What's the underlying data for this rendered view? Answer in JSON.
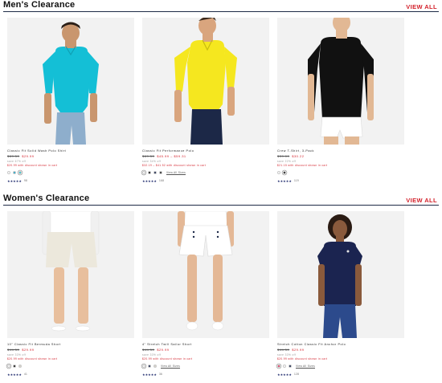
{
  "men": {
    "title": "Men's Clearance",
    "view_all": "VIEW ALL",
    "products": [
      {
        "name": "Classic Fit Solid Wash Polo Shirt",
        "was": "$89.50",
        "now": "$29.99",
        "save": "save 67% off",
        "promo": "$20.99 with discount shown in cart",
        "swatches": [
          "#ffffff",
          "#1aa7cc",
          "#1ec9d8"
        ],
        "selected": 2,
        "view_more": "",
        "stars": "★★★★★",
        "count": "98"
      },
      {
        "name": "Classic Fit Performance Polo",
        "was": "$89.50",
        "now": "$45.99 – $59.31",
        "save": "save 34% off",
        "promo": "$32.19 – $41.52 with discount shown in cart",
        "swatches": [
          "#ffffff",
          "#111111",
          "#15224a",
          "#222222"
        ],
        "selected": 0,
        "view_more": "View All Sizes",
        "stars": "★★★★★",
        "count": "168"
      },
      {
        "name": "Crew T-Shirt, 3-Pack",
        "was": "$39.00",
        "now": "$30.22",
        "save": "save 22% off",
        "promo": "$21.15 with discount shown in cart",
        "swatches": [
          "#ffffff",
          "#111111"
        ],
        "selected": 1,
        "view_more": "",
        "stars": "★★★★★",
        "count": "119"
      }
    ]
  },
  "women": {
    "title": "Women's Clearance",
    "view_all": "VIEW ALL",
    "products": [
      {
        "name": "10\" Classic Fit Bermuda Short",
        "was": "$44.50",
        "now": "$29.99",
        "save": "save 33% off",
        "promo": "$20.99 with discount shown in cart",
        "swatches": [
          "#ffffff",
          "#111111",
          "#d9d6cc"
        ],
        "selected": 0,
        "view_more": "",
        "stars": "★★★★★",
        "count": "41"
      },
      {
        "name": "4\" Stretch Twill Sailor Short",
        "was": "$44.50",
        "now": "$29.99",
        "save": "save 33% off",
        "promo": "$20.99 with discount shown in cart",
        "swatches": [
          "#ffffff",
          "#15224a",
          "#d9d6cc"
        ],
        "selected": 0,
        "view_more": "View All Sizes",
        "stars": "★★★★★",
        "count": "36"
      },
      {
        "name": "Stretch Cotton Classic Fit Anchor Polo",
        "was": "$44.50",
        "now": "$29.99",
        "save": "save 33% off",
        "promo": "$20.99 with discount shown in cart",
        "swatches": [
          "#e52b5a",
          "#ffffff",
          "#15224a"
        ],
        "selected": 0,
        "view_more": "View All Sizes",
        "stars": "★★★★★",
        "count": "128"
      }
    ]
  }
}
